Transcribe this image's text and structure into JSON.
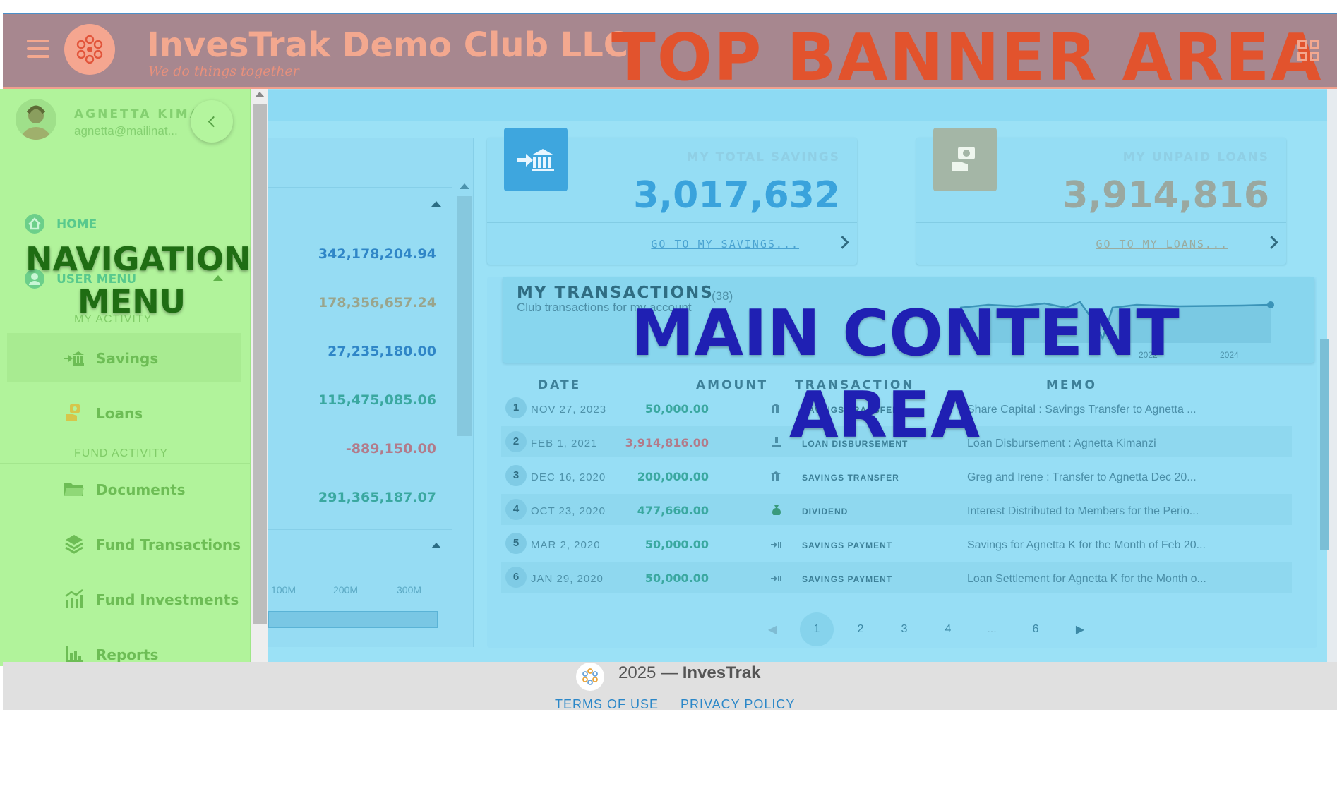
{
  "header": {
    "title": "InvesTrak Demo Club LLC",
    "subtitle": "We do things together",
    "banner_label": "TOP BANNER AREA",
    "menu_icon": "hamburger-menu-icon",
    "apps_icon": "grid-apps-icon"
  },
  "sidebar": {
    "user_name": "AGNETTA KIMA",
    "user_email": "agnetta@mailinat...",
    "home": "HOME",
    "user_menu": "USER MENU",
    "section_my_activity": "MY ACTIVITY",
    "section_fund_activity": "FUND ACTIVITY",
    "items": [
      {
        "label": "Savings",
        "icon": "savings-bank-icon"
      },
      {
        "label": "Loans",
        "icon": "loans-hand-icon"
      },
      {
        "label": "Documents",
        "icon": "folder-icon"
      },
      {
        "label": "Fund Transactions",
        "icon": "layers-icon"
      },
      {
        "label": "Fund Investments",
        "icon": "investments-chart-icon"
      },
      {
        "label": "Reports",
        "icon": "reports-chart-icon"
      }
    ],
    "overlay_line1": "NAVIGATION",
    "overlay_line2": "MENU"
  },
  "left_panel": {
    "values": [
      "342,178,204.94",
      "178,356,657.24",
      "27,235,180.00",
      "115,475,085.06",
      "-889,150.00",
      "291,365,187.07"
    ],
    "value_colors": [
      "#2f86c7",
      "#9aa58c",
      "#2f86c7",
      "#3aa8a0",
      "#b27b8a",
      "#3aa8a0"
    ],
    "axis_ticks": [
      "100M",
      "200M",
      "300M"
    ]
  },
  "stats": {
    "savings": {
      "label": "MY TOTAL SAVINGS",
      "value": "3,017,632",
      "link": "GO TO MY SAVINGS...",
      "color": "#3aa3dc"
    },
    "loans": {
      "label": "MY UNPAID LOANS",
      "value": "3,914,816",
      "link": "GO TO MY LOANS...",
      "color": "#9aa8a0"
    }
  },
  "transactions": {
    "title": "MY TRANSACTIONS",
    "count": "(38)",
    "subtitle": "Club transactions for my account",
    "sparkline_labels": [
      "2022",
      "2024"
    ],
    "columns": {
      "date": "DATE",
      "amount": "AMOUNT",
      "transaction": "TRANSACTION",
      "memo": "MEMO"
    },
    "rows": [
      {
        "n": "1",
        "date": "NOV 27, 2023",
        "amount": "50,000.00",
        "amount_color": "#3aa8a0",
        "type": "SAVINGS TRANSFER",
        "memo": "Share Capital : Savings Transfer to Agnetta ..."
      },
      {
        "n": "2",
        "date": "FEB 1, 2021",
        "amount": "3,914,816.00",
        "amount_color": "#b27b8a",
        "type": "LOAN DISBURSEMENT",
        "memo": "Loan Disbursement : Agnetta Kimanzi"
      },
      {
        "n": "3",
        "date": "DEC 16, 2020",
        "amount": "200,000.00",
        "amount_color": "#3aa8a0",
        "type": "SAVINGS TRANSFER",
        "memo": "Greg and Irene : Transfer to Agnetta Dec 20..."
      },
      {
        "n": "4",
        "date": "OCT 23, 2020",
        "amount": "477,660.00",
        "amount_color": "#3aa8a0",
        "type": "DIVIDEND",
        "memo": "Interest Distributed to Members for the Perio..."
      },
      {
        "n": "5",
        "date": "MAR 2, 2020",
        "amount": "50,000.00",
        "amount_color": "#3aa8a0",
        "type": "SAVINGS PAYMENT",
        "memo": "Savings for Agnetta K for the Month of Feb 20..."
      },
      {
        "n": "6",
        "date": "JAN 29, 2020",
        "amount": "50,000.00",
        "amount_color": "#3aa8a0",
        "type": "SAVINGS PAYMENT",
        "memo": "Loan Settlement for Agnetta K for the Month o..."
      }
    ],
    "pages": [
      "1",
      "2",
      "3",
      "4",
      "...",
      "6"
    ],
    "active_page": "1"
  },
  "main_label": {
    "line1": "MAIN CONTENT",
    "line2": "AREA"
  },
  "footer": {
    "year_text": "2025 —",
    "brand": "InvesTrak",
    "terms": "TERMS OF USE",
    "privacy": "PRIVACY POLICY"
  }
}
